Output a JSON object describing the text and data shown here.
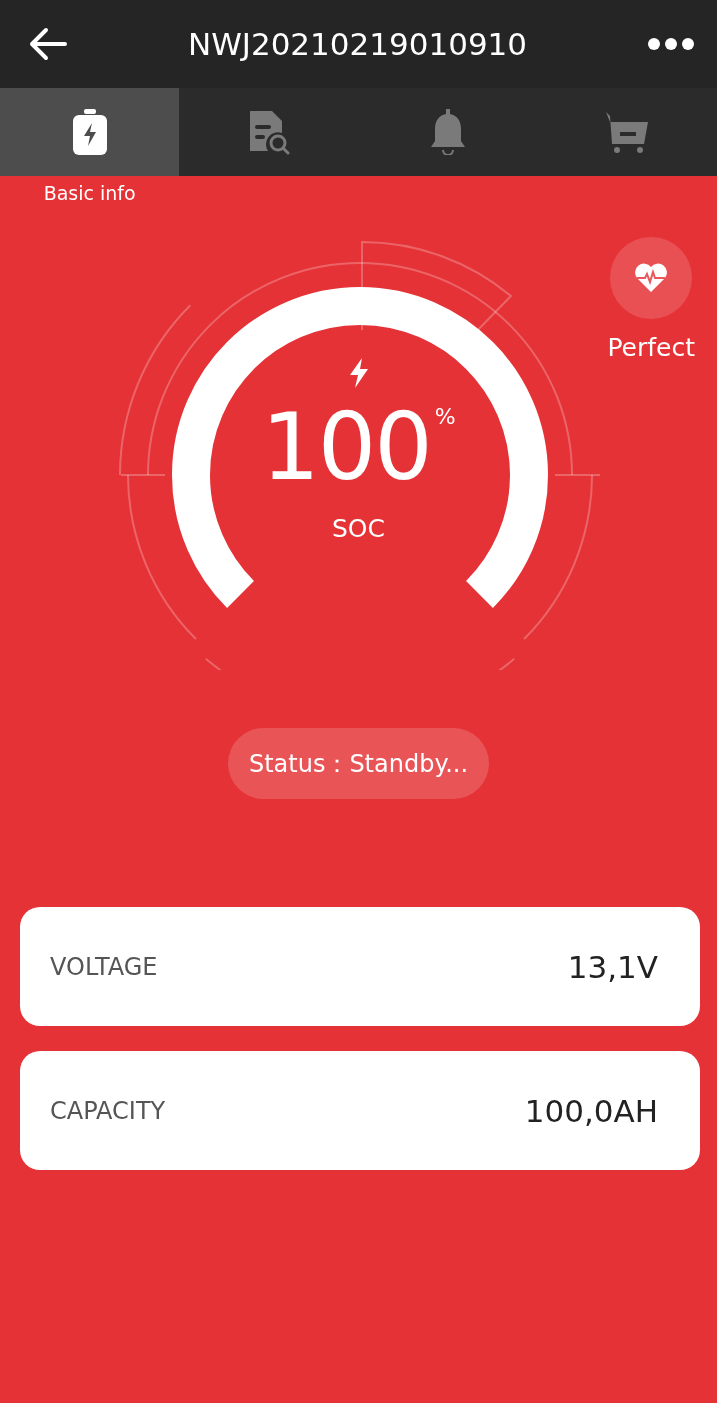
{
  "header": {
    "title": "NWJ20210219010910"
  },
  "tabs": [
    {
      "kind": "battery",
      "label": "Basic info",
      "selected": true
    },
    {
      "kind": "report",
      "selected": false
    },
    {
      "kind": "bell",
      "selected": false
    },
    {
      "kind": "cart",
      "selected": false
    }
  ],
  "gauge": {
    "value": "100",
    "unit": "%",
    "caption": "SOC"
  },
  "health": {
    "label": "Perfect"
  },
  "status": {
    "text": "Status：Standby..."
  },
  "metrics": [
    {
      "label": "VOLTAGE",
      "value": "13,1V"
    },
    {
      "label": "CAPACITY",
      "value": "100,0AH"
    }
  ]
}
